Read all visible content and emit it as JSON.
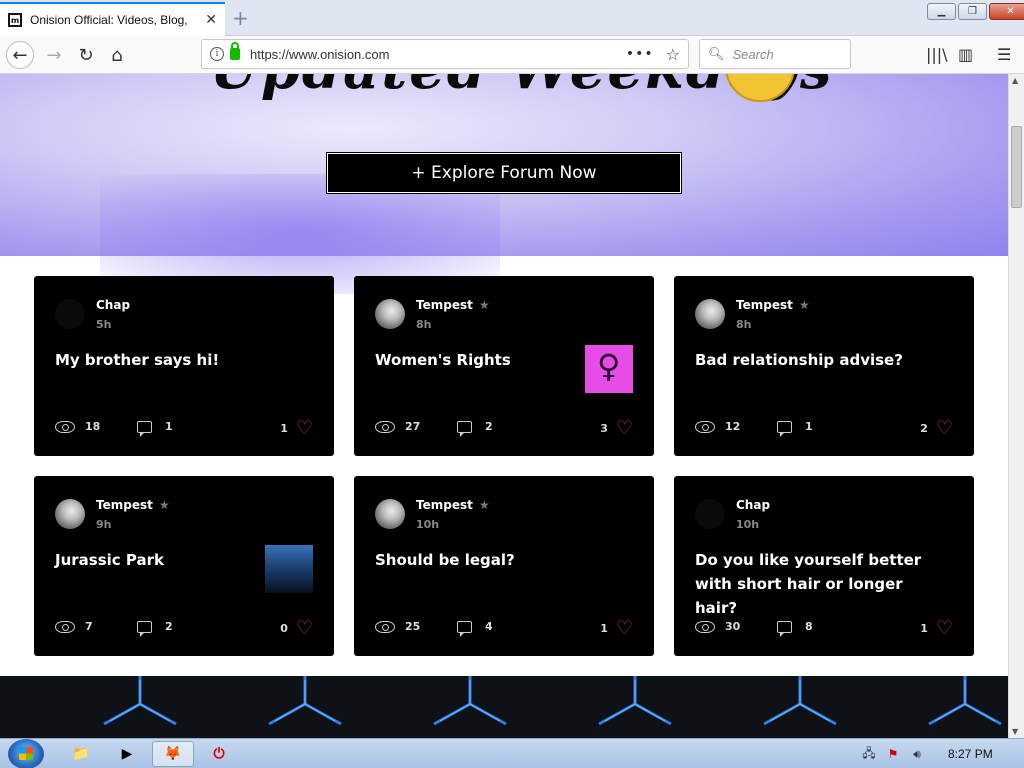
{
  "browser": {
    "tab_title": "Onision Official: Videos, Blog, F",
    "url_host": "https://www.onision.com",
    "search_placeholder": "Search"
  },
  "hero": {
    "script_text": "Updated Weekdays",
    "explore_button": "+ Explore Forum Now"
  },
  "posts": [
    {
      "author": "Chap",
      "time": "5h",
      "title": "My brother says hi!",
      "views": "18",
      "comments": "1",
      "likes": "1",
      "starred": false,
      "avatar": "blank",
      "thumb": ""
    },
    {
      "author": "Tempest",
      "time": "8h",
      "title": "Women's Rights",
      "views": "27",
      "comments": "2",
      "likes": "3",
      "starred": true,
      "avatar": "photo",
      "thumb": "feminism"
    },
    {
      "author": "Tempest",
      "time": "8h",
      "title": "Bad relationship advise?",
      "views": "12",
      "comments": "1",
      "likes": "2",
      "starred": true,
      "avatar": "photo",
      "thumb": ""
    },
    {
      "author": "Tempest",
      "time": "9h",
      "title": "Jurassic Park",
      "views": "7",
      "comments": "2",
      "likes": "0",
      "starred": true,
      "avatar": "photo",
      "thumb": "jurassic"
    },
    {
      "author": "Tempest",
      "time": "10h",
      "title": "Should be legal?",
      "views": "25",
      "comments": "4",
      "likes": "1",
      "starred": true,
      "avatar": "photo",
      "thumb": ""
    },
    {
      "author": "Chap",
      "time": "10h",
      "title": "Do you like yourself better with short hair or longer hair?",
      "views": "30",
      "comments": "8",
      "likes": "1",
      "starred": false,
      "avatar": "blank",
      "thumb": ""
    }
  ],
  "taskbar": {
    "clock": "8:27 PM"
  },
  "colors": {
    "heart": "#b8302a",
    "card_bg": "#000000",
    "hero_accent": "#8f83ee"
  }
}
